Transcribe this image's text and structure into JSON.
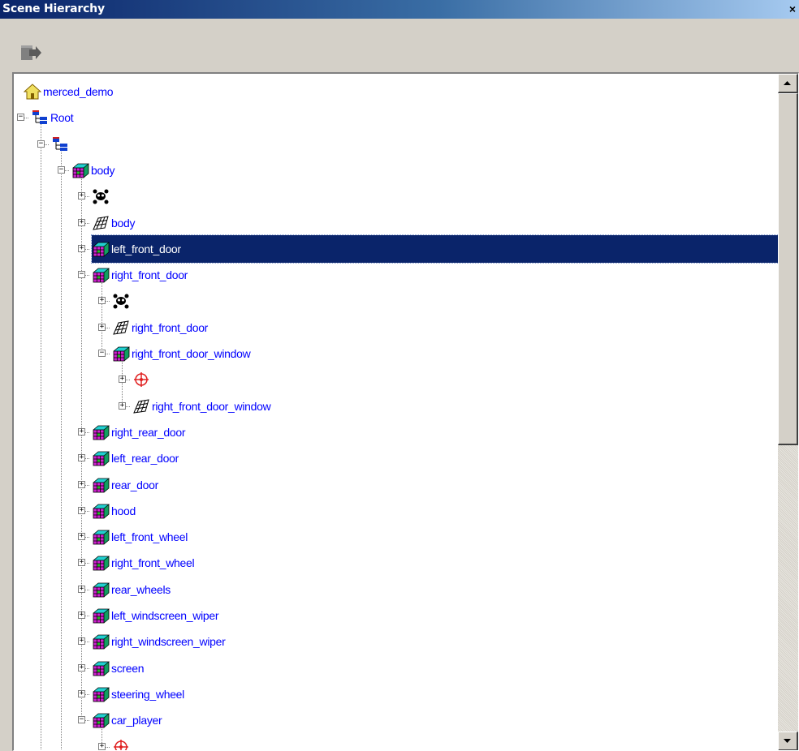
{
  "window": {
    "title": "Scene Hierarchy",
    "close_label": "×"
  },
  "toolbar": {
    "button_icon": "export-scene-icon"
  },
  "colors": {
    "selection": "#0a246a",
    "label": "#0000ff",
    "titlebar_start": "#0a246a",
    "titlebar_end": "#a6caf0"
  },
  "tree": [
    {
      "label": "merced_demo",
      "icon": "home-icon",
      "depth": 0,
      "expander": "none"
    },
    {
      "label": "Root",
      "icon": "hierarchy-icon",
      "depth": 0,
      "expander": "minus"
    },
    {
      "label": "",
      "icon": "hierarchy-icon",
      "depth": 1,
      "expander": "minus"
    },
    {
      "label": "body",
      "icon": "cube-icon",
      "depth": 2,
      "expander": "minus"
    },
    {
      "label": "",
      "icon": "skull-icon",
      "depth": 3,
      "expander": "plus"
    },
    {
      "label": "body",
      "icon": "mesh-icon",
      "depth": 3,
      "expander": "plus"
    },
    {
      "label": "left_front_door",
      "icon": "cube-icon",
      "depth": 3,
      "expander": "plus",
      "selected": true
    },
    {
      "label": "right_front_door",
      "icon": "cube-icon",
      "depth": 3,
      "expander": "minus"
    },
    {
      "label": "",
      "icon": "skull-icon",
      "depth": 4,
      "expander": "plus"
    },
    {
      "label": "right_front_door",
      "icon": "mesh-icon",
      "depth": 4,
      "expander": "plus"
    },
    {
      "label": "right_front_door_window",
      "icon": "cube-icon",
      "depth": 4,
      "expander": "minus"
    },
    {
      "label": "",
      "icon": "crosshair-icon",
      "depth": 5,
      "expander": "plus"
    },
    {
      "label": "right_front_door_window",
      "icon": "mesh-icon",
      "depth": 5,
      "expander": "plus"
    },
    {
      "label": "right_rear_door",
      "icon": "cube-icon",
      "depth": 3,
      "expander": "plus"
    },
    {
      "label": "left_rear_door",
      "icon": "cube-icon",
      "depth": 3,
      "expander": "plus"
    },
    {
      "label": "rear_door",
      "icon": "cube-icon",
      "depth": 3,
      "expander": "plus"
    },
    {
      "label": "hood",
      "icon": "cube-icon",
      "depth": 3,
      "expander": "plus"
    },
    {
      "label": "left_front_wheel",
      "icon": "cube-icon",
      "depth": 3,
      "expander": "plus"
    },
    {
      "label": "right_front_wheel",
      "icon": "cube-icon",
      "depth": 3,
      "expander": "plus"
    },
    {
      "label": "rear_wheels",
      "icon": "cube-icon",
      "depth": 3,
      "expander": "plus"
    },
    {
      "label": "left_windscreen_wiper",
      "icon": "cube-icon",
      "depth": 3,
      "expander": "plus"
    },
    {
      "label": "right_windscreen_wiper",
      "icon": "cube-icon",
      "depth": 3,
      "expander": "plus"
    },
    {
      "label": "screen",
      "icon": "cube-icon",
      "depth": 3,
      "expander": "plus"
    },
    {
      "label": "steering_wheel",
      "icon": "cube-icon",
      "depth": 3,
      "expander": "plus"
    },
    {
      "label": "car_player",
      "icon": "cube-icon",
      "depth": 3,
      "expander": "minus"
    },
    {
      "label": "",
      "icon": "crosshair-icon",
      "depth": 4,
      "expander": "plus"
    }
  ],
  "scrollbar": {
    "position": 0.0,
    "visible_fraction": 0.52
  }
}
